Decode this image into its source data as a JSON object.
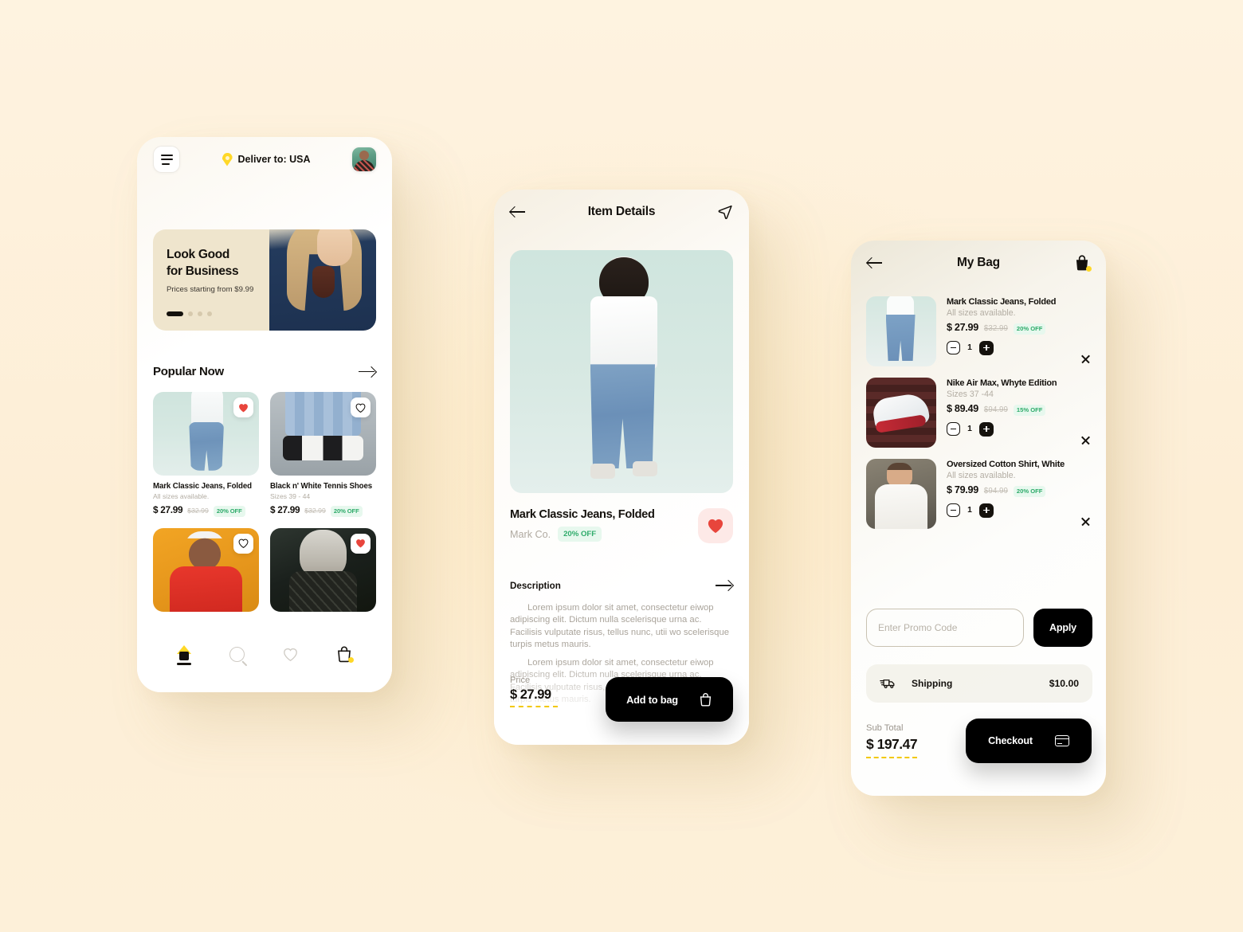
{
  "app": {
    "background_color": "#fdf1da",
    "accent_yellow": "#ffd827",
    "dark": "#14110d",
    "badge_green_text": "#2eab6a",
    "badge_green_bg": "#e7f8ee"
  },
  "home": {
    "header": {
      "menu_icon": "hamburger-icon",
      "location_icon": "map-pin-icon",
      "deliver_label": "Deliver to: USA",
      "avatar_icon": "user-avatar"
    },
    "banner": {
      "title_line1": "Look Good",
      "title_line2": "for Business",
      "subtitle": "Prices starting from $9.99",
      "dots": 4,
      "active_dot": 0
    },
    "section": {
      "title": "Popular Now",
      "arrow_icon": "arrow-right-icon"
    },
    "products": [
      {
        "name": "Mark Classic Jeans, Folded",
        "sub": "All sizes available.",
        "price": "$ 27.99",
        "old_price": "$32.99",
        "discount": "20% OFF",
        "favorited": true,
        "image": "img-jeans"
      },
      {
        "name": "Black n' White Tennis Shoes",
        "sub": "Sizes 39 - 44",
        "price": "$ 27.99",
        "old_price": "$32.99",
        "discount": "20% OFF",
        "favorited": false,
        "image": "img-shoes"
      },
      {
        "name": "",
        "sub": "",
        "price": "",
        "old_price": "",
        "discount": "",
        "favorited": false,
        "image": "img-orange"
      },
      {
        "name": "",
        "sub": "",
        "price": "",
        "old_price": "",
        "discount": "",
        "favorited": true,
        "image": "img-dark"
      }
    ],
    "nav": [
      {
        "icon": "home-icon",
        "active": true
      },
      {
        "icon": "search-icon",
        "active": false
      },
      {
        "icon": "heart-icon",
        "active": false
      },
      {
        "icon": "shopping-bag-icon",
        "active": false,
        "has_badge": true
      }
    ]
  },
  "details": {
    "header": {
      "back_icon": "arrow-left-icon",
      "title": "Item Details",
      "share_icon": "send-icon"
    },
    "product": {
      "name": "Mark Classic Jeans, Folded",
      "brand": "Mark Co.",
      "discount": "20% OFF",
      "favorited": true
    },
    "description": {
      "title": "Description",
      "arrow_icon": "arrow-right-icon",
      "paragraph1": "Lorem ipsum dolor sit amet, consectetur eiwop adipiscing elit. Dictum nulla scelerisque urna ac. Facilisis vulputate risus, tellus nunc, utii wo scelerisque turpis metus mauris.",
      "paragraph2": "Lorem ipsum dolor sit amet, consectetur eiwop adipiscing elit. Dictum nulla scelerisque urna ac. Facilisis vulputate risus, tellus nunc, utii wo scelerisque turpis metus mauris."
    },
    "price": {
      "label": "Price",
      "value": "$ 27.99"
    },
    "add_to_bag": {
      "label": "Add to bag",
      "icon": "shopping-bag-icon"
    }
  },
  "bag": {
    "header": {
      "back_icon": "arrow-left-icon",
      "title": "My Bag",
      "bag_icon": "shopping-bag-icon"
    },
    "items": [
      {
        "name": "Mark Classic Jeans, Folded",
        "sub": "All sizes available.",
        "price": "$ 27.99",
        "old_price": "$32.99",
        "discount": "20% OFF",
        "qty": "1",
        "image": "img-bagjeans"
      },
      {
        "name": "Nike Air Max, Whyte Edition",
        "sub": "Sizes 37 -44",
        "price": "$ 89.49",
        "old_price": "$94.99",
        "discount": "15% OFF",
        "qty": "1",
        "image": "img-nike"
      },
      {
        "name": "Oversized Cotton Shirt, White",
        "sub": "All sizes available.",
        "price": "$ 79.99",
        "old_price": "$94.99",
        "discount": "20% OFF",
        "qty": "1",
        "image": "img-shirt"
      }
    ],
    "promo": {
      "placeholder": "Enter Promo Code",
      "value": "",
      "apply_label": "Apply"
    },
    "shipping": {
      "icon": "truck-icon",
      "label": "Shipping",
      "value": "$10.00"
    },
    "total": {
      "label": "Sub Total",
      "value": "$ 197.47"
    },
    "checkout": {
      "label": "Checkout",
      "icon": "credit-card-icon"
    }
  }
}
